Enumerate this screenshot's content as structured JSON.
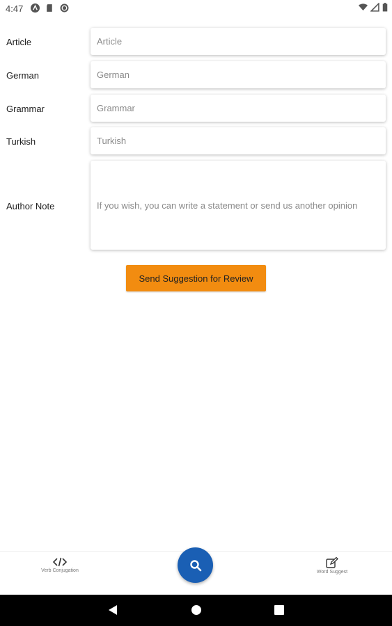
{
  "status": {
    "time": "4:47"
  },
  "form": {
    "article": {
      "label": "Article",
      "placeholder": "Article"
    },
    "german": {
      "label": "German",
      "placeholder": "German"
    },
    "grammar": {
      "label": "Grammar",
      "placeholder": "Grammar"
    },
    "turkish": {
      "label": "Turkish",
      "placeholder": "Turkish"
    },
    "author_note": {
      "label": "Author Note",
      "placeholder": "If you wish, you can write a statement or send us another opinion"
    }
  },
  "actions": {
    "send_label": "Send Suggestion for Review"
  },
  "bottom_nav": {
    "left": {
      "label": "Verb Conjugation",
      "icon": "code-icon"
    },
    "center": {
      "icon": "search-icon"
    },
    "right": {
      "label": "Word Suggest",
      "icon": "edit-icon"
    }
  },
  "colors": {
    "accent": "#f28c10",
    "fab": "#1a5fb4"
  }
}
